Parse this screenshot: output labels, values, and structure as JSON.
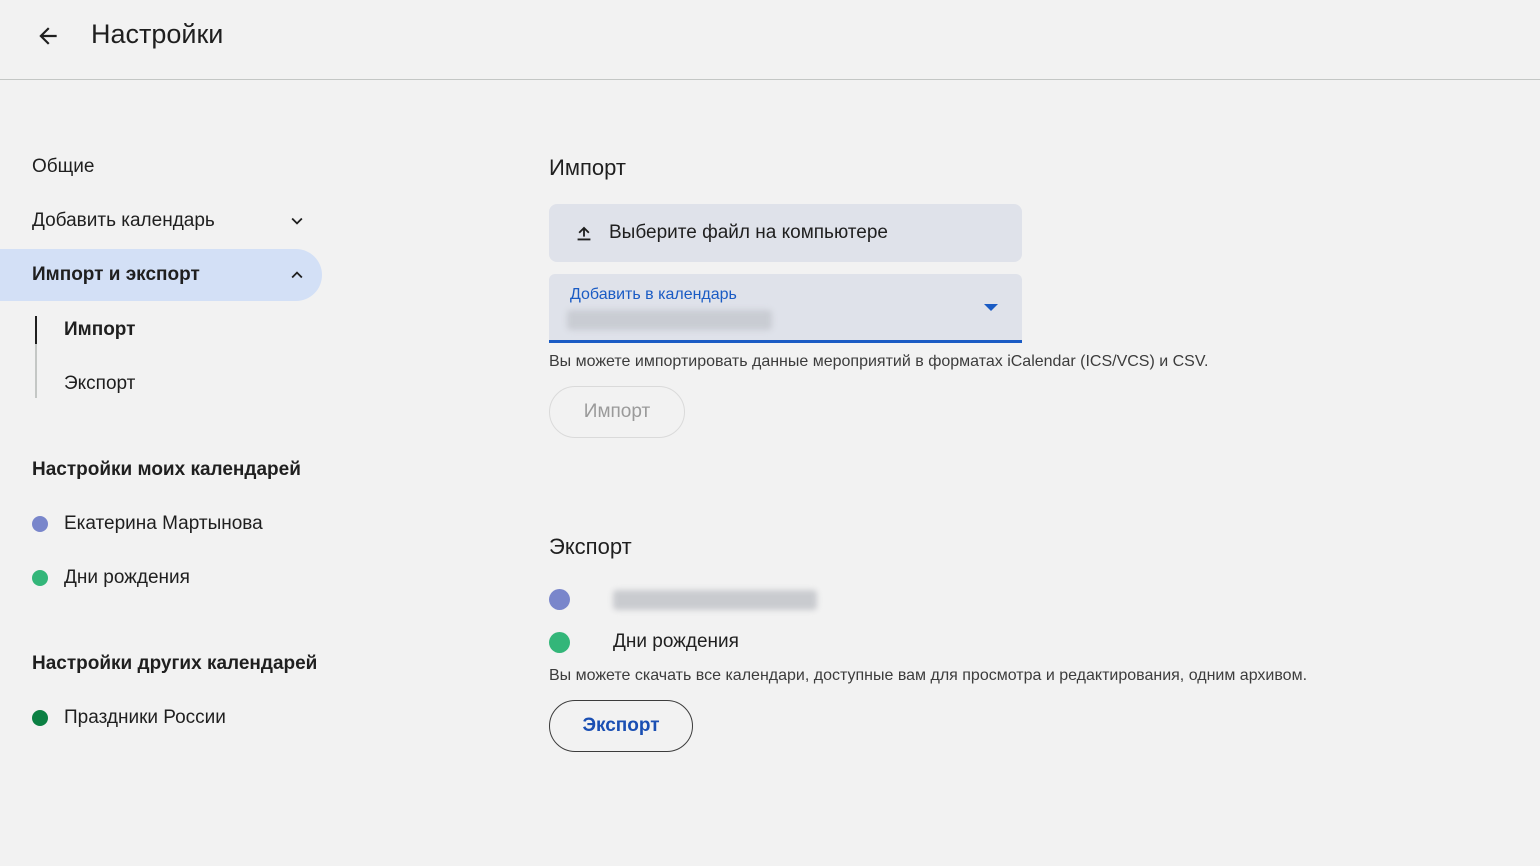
{
  "header": {
    "title": "Настройки",
    "back_icon": "arrow-back-icon"
  },
  "sidebar": {
    "general": "Общие",
    "add_calendar": "Добавить календарь",
    "import_export": "Импорт и экспорт",
    "sub_import": "Импорт",
    "sub_export": "Экспорт",
    "my_calendars_head": "Настройки моих календарей",
    "my_calendars": [
      {
        "name": "Екатерина Мартынова",
        "color": "#7986cb"
      },
      {
        "name": "Дни рождения",
        "color": "#33b679"
      }
    ],
    "other_calendars_head": "Настройки других календарей",
    "other_calendars": [
      {
        "name": "Праздники России",
        "color": "#0b8043"
      }
    ]
  },
  "import": {
    "title": "Импорт",
    "file_button": "Выберите файл на компьютере",
    "select_label": "Добавить в календарь",
    "hint": "Вы можете импортировать данные мероприятий в форматах iCalendar (ICS/VCS) и CSV.",
    "button": "Импорт"
  },
  "export": {
    "title": "Экспорт",
    "calendars": [
      {
        "name": "",
        "color": "#7986cb"
      },
      {
        "name": "Дни рождения",
        "color": "#33b679"
      }
    ],
    "hint": "Вы можете скачать все календари, доступные вам для просмотра и редактирования, одним архивом.",
    "button": "Экспорт"
  },
  "colors": {
    "accent": "#1a5bc4",
    "active_nav": "#d3e0f6"
  }
}
